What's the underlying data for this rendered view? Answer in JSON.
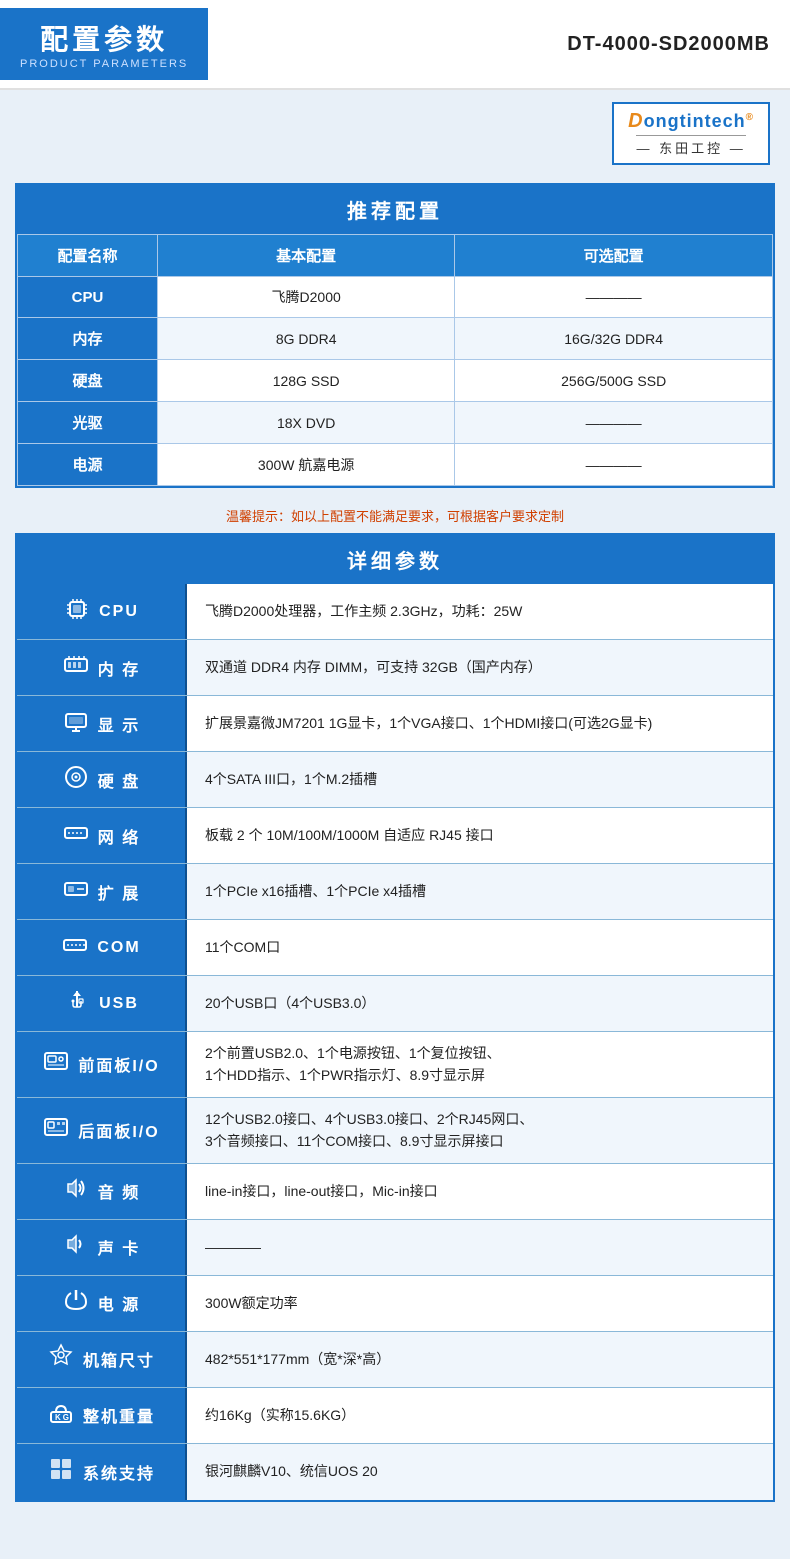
{
  "header": {
    "title_cn": "配置参数",
    "title_en": "PRODUCT PARAMETERS",
    "model": "DT-4000-SD2000MB"
  },
  "logo": {
    "brand": "Dongtintech",
    "brand_reg": "®",
    "subtitle": "— 东田工控 —"
  },
  "recommended": {
    "section_title": "推荐配置",
    "col_name": "配置名称",
    "col_basic": "基本配置",
    "col_optional": "可选配置",
    "rows": [
      {
        "name": "CPU",
        "basic": "飞腾D2000",
        "optional": "————"
      },
      {
        "name": "内存",
        "basic": "8G DDR4",
        "optional": "16G/32G DDR4"
      },
      {
        "name": "硬盘",
        "basic": "128G SSD",
        "optional": "256G/500G SSD"
      },
      {
        "name": "光驱",
        "basic": "18X DVD",
        "optional": "————"
      },
      {
        "name": "电源",
        "basic": "300W 航嘉电源",
        "optional": "————"
      }
    ],
    "warm_tip": "温馨提示：如以上配置不能满足要求，可根据客户要求定制"
  },
  "detail": {
    "section_title": "详细参数",
    "rows": [
      {
        "icon": "cpu",
        "label": "CPU",
        "value": "飞腾D2000处理器，工作主频 2.3GHz，功耗：25W"
      },
      {
        "icon": "mem",
        "label": "内 存",
        "value": "双通道 DDR4 内存 DIMM，可支持 32GB（国产内存）"
      },
      {
        "icon": "display",
        "label": "显 示",
        "value": "扩展景嘉微JM7201 1G显卡，1个VGA接口、1个HDMI接口(可选2G显卡)"
      },
      {
        "icon": "hdd",
        "label": "硬 盘",
        "value": "4个SATA III口，1个M.2插槽"
      },
      {
        "icon": "net",
        "label": "网 络",
        "value": "板载 2 个 10M/100M/1000M 自适应 RJ45 接口"
      },
      {
        "icon": "expand",
        "label": "扩 展",
        "value": "1个PCIe x16插槽、1个PCIe x4插槽"
      },
      {
        "icon": "com",
        "label": "COM",
        "value": "11个COM口"
      },
      {
        "icon": "usb",
        "label": "USB",
        "value": "20个USB口（4个USB3.0）"
      },
      {
        "icon": "front",
        "label": "前面板I/O",
        "value": "2个前置USB2.0、1个电源按钮、1个复位按钮、\n1个HDD指示、1个PWR指示灯、8.9寸显示屏"
      },
      {
        "icon": "rear",
        "label": "后面板I/O",
        "value": "12个USB2.0接口、4个USB3.0接口、2个RJ45网口、\n3个音频接口、11个COM接口、8.9寸显示屏接口"
      },
      {
        "icon": "audio",
        "label": "音 频",
        "value": "line-in接口，line-out接口，Mic-in接口"
      },
      {
        "icon": "soundcard",
        "label": "声 卡",
        "value": "————"
      },
      {
        "icon": "power",
        "label": "电 源",
        "value": "300W额定功率"
      },
      {
        "icon": "chassis",
        "label": "机箱尺寸",
        "value": "482*551*177mm（宽*深*高）"
      },
      {
        "icon": "weight",
        "label": "整机重量",
        "value": "约16Kg（实称15.6KG）"
      },
      {
        "icon": "os",
        "label": "系统支持",
        "value": "银河麒麟V10、统信UOS 20"
      }
    ]
  }
}
